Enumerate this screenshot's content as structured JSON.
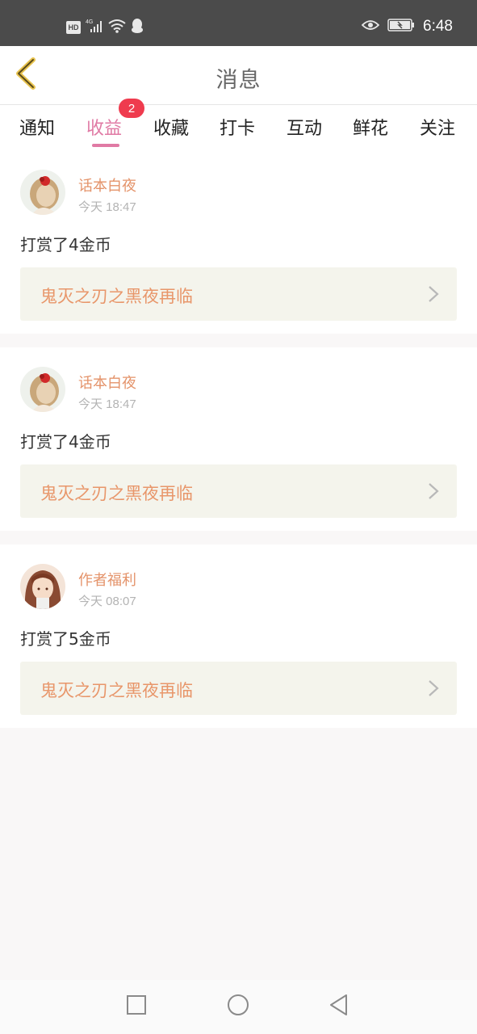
{
  "status_bar": {
    "network": "4G",
    "hd": "HD",
    "time": "6:48"
  },
  "header": {
    "title": "消息"
  },
  "tabs": [
    {
      "label": "通知"
    },
    {
      "label": "收益",
      "badge": "2",
      "active": true
    },
    {
      "label": "收藏"
    },
    {
      "label": "打卡"
    },
    {
      "label": "互动"
    },
    {
      "label": "鲜花"
    },
    {
      "label": "关注"
    }
  ],
  "messages": [
    {
      "username": "话本白夜",
      "time": "今天 18:47",
      "action": "打赏了4金币",
      "book": "鬼灭之刃之黑夜再临"
    },
    {
      "username": "话本白夜",
      "time": "今天 18:47",
      "action": "打赏了4金币",
      "book": "鬼灭之刃之黑夜再临"
    },
    {
      "username": "作者福利",
      "time": "今天 08:07",
      "action": "打赏了5金币",
      "book": "鬼灭之刃之黑夜再临"
    }
  ],
  "colors": {
    "accent": "#e07aa4",
    "username": "#e4936a",
    "badge": "#ef3b4e",
    "book_bg": "#f4f4ec"
  }
}
